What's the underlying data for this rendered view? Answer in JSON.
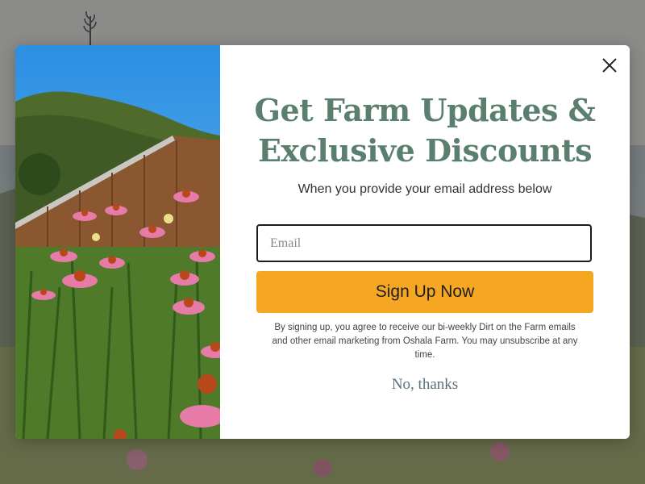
{
  "popup": {
    "title": "Get Farm Updates & Exclusive Discounts",
    "subtitle": "When you provide your email address below",
    "email_placeholder": "Email",
    "email_value": "",
    "signup_label": "Sign Up Now",
    "disclaimer": "By signing up, you agree to receive our bi-weekly Dirt on the Farm emails and other email marketing from Oshala Farm. You may unsubscribe at any time.",
    "decline_label": "No, thanks",
    "close_icon": "close-icon",
    "photo": "barn-and-coneflowers-photo"
  },
  "colors": {
    "title": "#5b7f6e",
    "button": "#f5a623",
    "overlay": "rgba(60,60,60,0.55)",
    "decline": "#5a6f7e"
  }
}
